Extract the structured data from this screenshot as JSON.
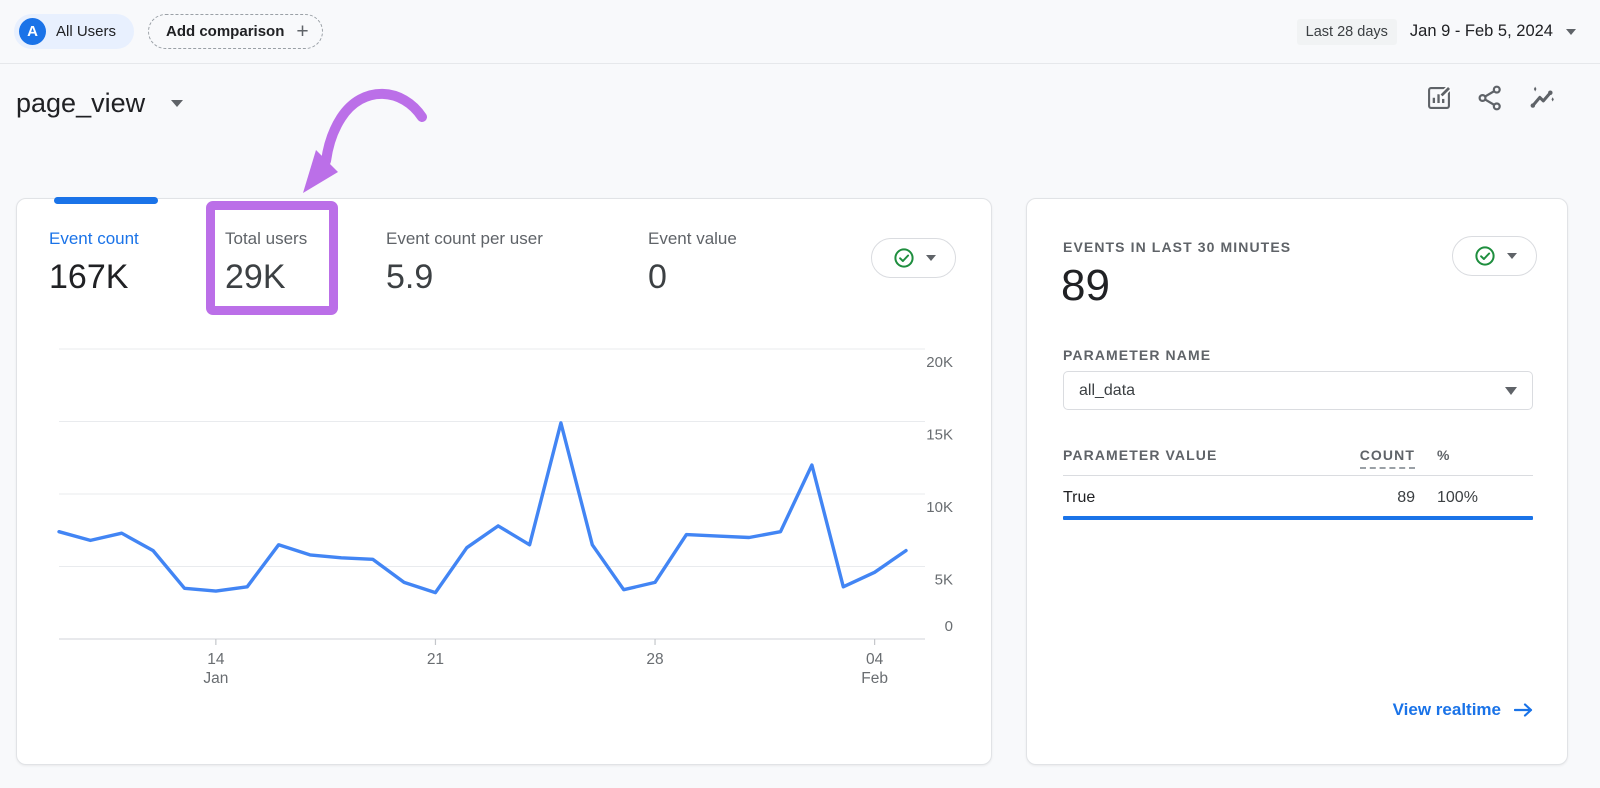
{
  "topbar": {
    "audience": {
      "avatar_letter": "A",
      "label": "All Users"
    },
    "add_comparison": {
      "label": "Add comparison",
      "plus": "+"
    },
    "date_range": {
      "preset": "Last 28 days",
      "range": "Jan 9 - Feb 5, 2024"
    }
  },
  "header": {
    "title": "page_view"
  },
  "metrics": {
    "selected_tab": "Event count",
    "highlighted_tab": "Total users",
    "tabs": [
      {
        "label": "Event count",
        "value": "167K"
      },
      {
        "label": "Total users",
        "value": "29K"
      },
      {
        "label": "Event count per user",
        "value": "5.9"
      },
      {
        "label": "Event value",
        "value": "0"
      }
    ]
  },
  "chart_data": {
    "type": "line",
    "series": "Event count",
    "x": [
      "Jan 9",
      "Jan 10",
      "Jan 11",
      "Jan 12",
      "Jan 13",
      "Jan 14",
      "Jan 15",
      "Jan 16",
      "Jan 17",
      "Jan 18",
      "Jan 19",
      "Jan 20",
      "Jan 21",
      "Jan 22",
      "Jan 23",
      "Jan 24",
      "Jan 25",
      "Jan 26",
      "Jan 27",
      "Jan 28",
      "Jan 29",
      "Jan 30",
      "Jan 31",
      "Feb 1",
      "Feb 2",
      "Feb 3",
      "Feb 4",
      "Feb 5"
    ],
    "values": [
      7400,
      6800,
      7300,
      6100,
      3500,
      3300,
      3600,
      6500,
      5800,
      5600,
      5500,
      3900,
      3200,
      6300,
      7800,
      6500,
      14900,
      6500,
      3400,
      3900,
      7200,
      7100,
      7000,
      7400,
      12000,
      3600,
      4600,
      6100
    ],
    "ylim": [
      0,
      20000
    ],
    "grid": true,
    "line_color": "#4285f4",
    "y_ticks": [
      {
        "label": "20K",
        "value": 20000
      },
      {
        "label": "15K",
        "value": 15000
      },
      {
        "label": "10K",
        "value": 10000
      },
      {
        "label": "5K",
        "value": 5000
      },
      {
        "label": "0",
        "value": 0
      }
    ],
    "x_ticks": [
      {
        "index": 5,
        "line1": "14",
        "line2": "Jan"
      },
      {
        "index": 12,
        "line1": "21",
        "line2": ""
      },
      {
        "index": 19,
        "line1": "28",
        "line2": ""
      },
      {
        "index": 26,
        "line1": "04",
        "line2": "Feb"
      }
    ]
  },
  "realtime": {
    "title": "EVENTS IN LAST 30 MINUTES",
    "value": "89",
    "parameter_name_label": "PARAMETER NAME",
    "parameter_selected": "all_data",
    "table": {
      "col_value": "PARAMETER VALUE",
      "col_count": "COUNT",
      "col_percent": "%",
      "rows": [
        {
          "value": "True",
          "count": "89",
          "percent": "100%",
          "bar_percent": 100
        }
      ]
    },
    "view_realtime_label": "View realtime"
  },
  "colors": {
    "accent_blue": "#1a73e8",
    "chart_line": "#4285f4",
    "success_green": "#1e8e3e",
    "annotation_purple": "#bb6fe8"
  }
}
